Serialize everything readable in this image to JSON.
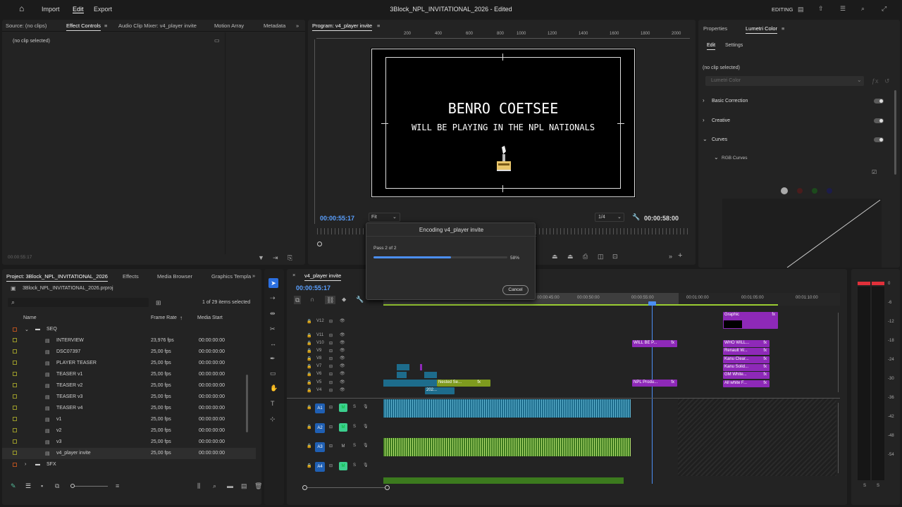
{
  "topbar": {
    "menu": [
      "Import",
      "Edit",
      "Export"
    ],
    "title": "3Block_NPL_INVITATIONAL_2026 - Edited",
    "workspace": "EDITING"
  },
  "source_panel": {
    "tabs": [
      "Source: (no clips)",
      "Effect Controls",
      "Audio Clip Mixer: v4_player invite",
      "Motion Array",
      "Metadata"
    ],
    "no_clip": "(no clip selected)",
    "timecode": "00:00:55:17"
  },
  "program": {
    "tab": "Program: v4_player invite",
    "ruler": [
      "200",
      "400",
      "600",
      "800",
      "1000",
      "1200",
      "1400",
      "1600",
      "1800",
      "2000"
    ],
    "headline": "BENRO COETSEE",
    "subline": "WILL BE PLAYING IN THE NPL NATIONALS",
    "timecode": "00:00:55:17",
    "fit": "Fit",
    "resolution": "1/4",
    "duration": "00:00:58:00"
  },
  "lumetri": {
    "tabs": [
      "Properties",
      "Lumetri Color"
    ],
    "subtabs": [
      "Edit",
      "Settings"
    ],
    "no_clip": "(no clip selected)",
    "effect": "Lumetri Color",
    "sections": [
      "Basic Correction",
      "Creative",
      "Curves"
    ],
    "subsection": "RGB Curves"
  },
  "project": {
    "tabs": [
      "Project: 3Block_NPL_INVITATIONAL_2026",
      "Effects",
      "Media Browser",
      "Graphics Templa"
    ],
    "file": "3Block_NPL_INVITATIONAL_2026.prproj",
    "selected_count": "1 of 29 items selected",
    "columns": [
      "Name",
      "Frame Rate",
      "Media Start"
    ],
    "folder_seq": "SEQ",
    "items": [
      {
        "name": "INTERVIEW",
        "rate": "23,976 fps",
        "start": "00:00:00:00"
      },
      {
        "name": "DSC07397",
        "rate": "25,00 fps",
        "start": "00:00:00:00"
      },
      {
        "name": "PLAYER TEASER",
        "rate": "25,00 fps",
        "start": "00:00:00:00"
      },
      {
        "name": "TEASER v1",
        "rate": "25,00 fps",
        "start": "00:00:00:00"
      },
      {
        "name": "TEASER v2",
        "rate": "25,00 fps",
        "start": "00:00:00:00"
      },
      {
        "name": "TEASER v3",
        "rate": "25,00 fps",
        "start": "00:00:00:00"
      },
      {
        "name": "TEASER v4",
        "rate": "25,00 fps",
        "start": "00:00:00:00"
      },
      {
        "name": "v1",
        "rate": "25,00 fps",
        "start": "00:00:00:00"
      },
      {
        "name": "v2",
        "rate": "25,00 fps",
        "start": "00:00:00:00"
      },
      {
        "name": "v3",
        "rate": "25,00 fps",
        "start": "00:00:00:00"
      },
      {
        "name": "v4_player invite",
        "rate": "25,00 fps",
        "start": "00:00:00:00"
      }
    ],
    "folder_sfx": "SFX"
  },
  "timeline": {
    "tab": "v4_player invite",
    "timecode": "00:00:55:17",
    "ruler": [
      "00:00:45:00",
      "00:00:50:00",
      "00:00:55:00",
      "00:01:00:00",
      "00:01:05:00",
      "00:01:10:00"
    ],
    "video_tracks": [
      "V12",
      "V11",
      "V10",
      "V9",
      "V8",
      "V7",
      "V6",
      "V5",
      "V4"
    ],
    "audio_tracks": [
      "A1",
      "A2",
      "A3",
      "A4"
    ],
    "clips": {
      "graphic": "Graphic",
      "will_be": "WILL BE P...",
      "npl_produ": "NPL Produ...",
      "nested": "Nested Se...",
      "c202": "202...",
      "stack": [
        "WHO WILL...",
        "Renault W...",
        "Kanu Clear...",
        "Kanu Solid...",
        "GM White...",
        "All white F..."
      ]
    },
    "meter_scale": [
      "0",
      "-6",
      "-12",
      "-18",
      "-24",
      "-30",
      "-36",
      "-42",
      "-48",
      "-54"
    ]
  },
  "dialog": {
    "title": "Encoding v4_player invite",
    "pass": "Pass 2 of 2",
    "percent": "58%",
    "progress": 0.58,
    "cancel": "Cancel"
  }
}
